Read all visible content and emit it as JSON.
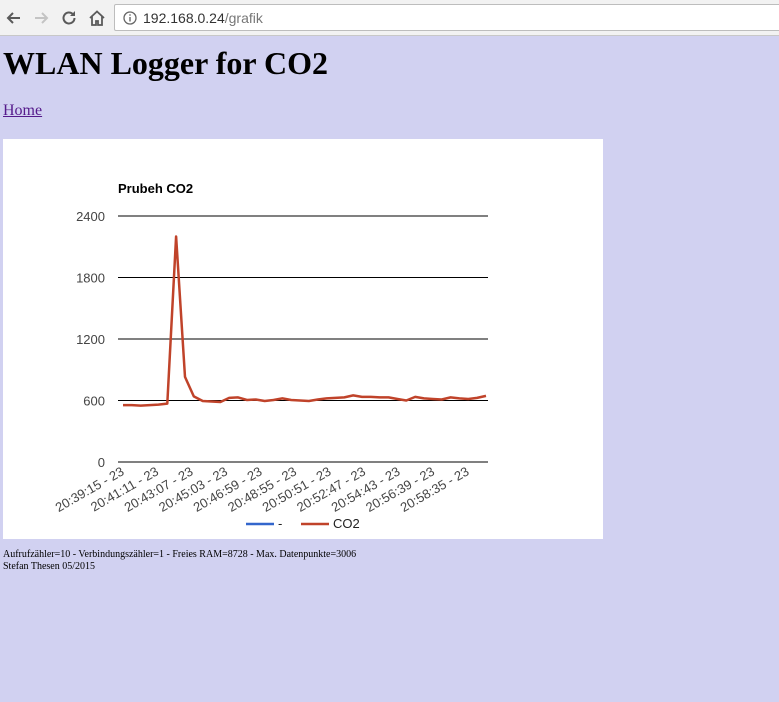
{
  "browser": {
    "url_host": "192.168.0.24",
    "url_path": "/grafik"
  },
  "page": {
    "title": "WLAN Logger for CO2",
    "home_link": "Home",
    "footer_line1": "Aufrufzähler=10 - Verbindungszähler=1 - Freies RAM=8728 - Max. Datenpunkte=3006",
    "footer_line2": "Stefan Thesen 05/2015"
  },
  "colors": {
    "page_bg": "#d1d1f1",
    "series_dash": "#3366cc",
    "series_co2": "#c0432a"
  },
  "chart_data": {
    "type": "line",
    "title": "Prubeh CO2",
    "ylim": [
      0,
      2400
    ],
    "yticks": [
      0,
      600,
      1200,
      1800,
      2400
    ],
    "ytick_labels": [
      "0",
      "600",
      "1200",
      "1800",
      "2400"
    ],
    "xtick_labels": [
      "20:39:15 - 23",
      "20:41:11 - 23",
      "20:43:07 - 23",
      "20:45:03 - 23",
      "20:46:59 - 23",
      "20:48:55 - 23",
      "20:50:51 - 23",
      "20:52:47 - 23",
      "20:54:43 - 23",
      "20:56:39 - 23",
      "20:58:35 - 23"
    ],
    "grid": true,
    "legend": "bottom",
    "series": [
      {
        "name": "-",
        "color": "#3366cc",
        "values": []
      },
      {
        "name": "CO2",
        "color": "#c0432a",
        "values": [
          555,
          555,
          550,
          555,
          560,
          570,
          2200,
          830,
          640,
          595,
          590,
          585,
          625,
          630,
          605,
          610,
          595,
          605,
          620,
          605,
          600,
          595,
          610,
          620,
          625,
          630,
          650,
          635,
          635,
          630,
          630,
          615,
          600,
          635,
          620,
          615,
          610,
          630,
          620,
          615,
          625,
          645
        ]
      }
    ]
  }
}
